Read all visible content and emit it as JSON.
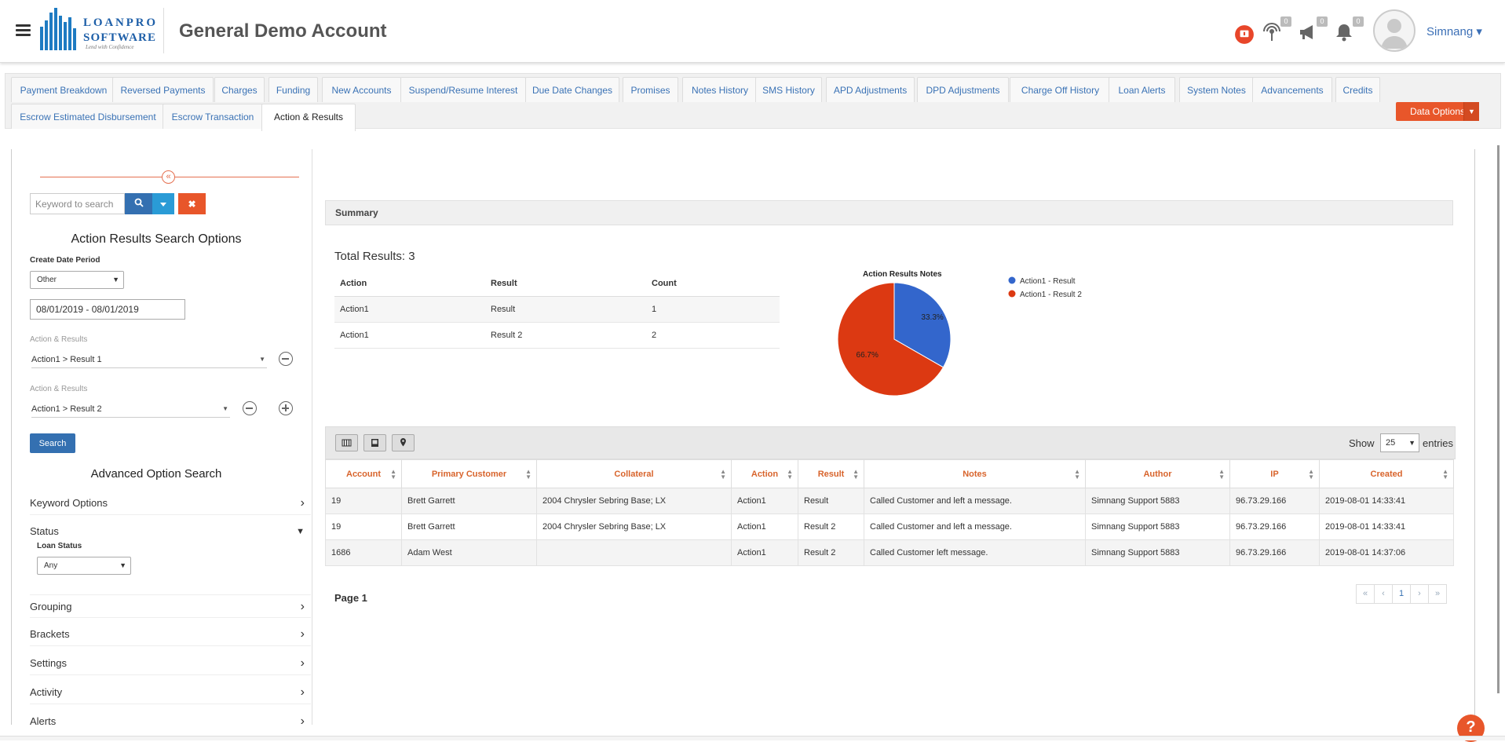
{
  "header": {
    "logo_text": "LOANPRO SOFTWARE",
    "logo_tagline": "Lend with Confidence",
    "account_title": "General Demo Account",
    "notif_counts": [
      "0",
      "0",
      "0"
    ],
    "user_name": "Simnang ▾"
  },
  "tabs": [
    {
      "label": "Payment Breakdown"
    },
    {
      "label": "Reversed Payments"
    },
    {
      "label": "Charges"
    },
    {
      "label": "Funding"
    },
    {
      "label": "New Accounts"
    },
    {
      "label": "Suspend/Resume Interest"
    },
    {
      "label": "Due Date Changes"
    },
    {
      "label": "Promises"
    },
    {
      "label": "Notes History"
    },
    {
      "label": "SMS History"
    },
    {
      "label": "APD Adjustments"
    },
    {
      "label": "DPD Adjustments"
    },
    {
      "label": "Charge Off History"
    },
    {
      "label": "Loan Alerts"
    },
    {
      "label": "System Notes"
    },
    {
      "label": "Advancements"
    },
    {
      "label": "Credits"
    },
    {
      "label": "Escrow Estimated Disbursement"
    },
    {
      "label": "Escrow Transaction"
    },
    {
      "label": "Action & Results",
      "active": true
    }
  ],
  "data_options_label": "Data Options",
  "left": {
    "keyword_placeholder": "Keyword to search",
    "search_options_title": "Action Results Search Options",
    "create_date_label": "Create Date Period",
    "create_date_value": "Other",
    "date_range": "08/01/2019 - 08/01/2019",
    "ar_label": "Action & Results",
    "ar1_value": "Action1 > Result 1",
    "ar2_value": "Action1 > Result 2",
    "search_label": "Search",
    "advanced_title": "Advanced Option Search",
    "acc_keyword": "Keyword Options",
    "acc_status": "Status",
    "loan_status_label": "Loan Status",
    "loan_status_value": "Any",
    "acc_grouping": "Grouping",
    "acc_brackets": "Brackets",
    "acc_settings": "Settings",
    "acc_activity": "Activity",
    "acc_alerts": "Alerts"
  },
  "summary": {
    "title": "Summary",
    "total": "Total Results: 3",
    "headers": [
      "Action",
      "Result",
      "Count"
    ],
    "rows": [
      [
        "Action1",
        "Result",
        "1"
      ],
      [
        "Action1",
        "Result 2",
        "2"
      ]
    ]
  },
  "chart_data": {
    "type": "pie",
    "title": "Action Results Notes",
    "labels": [
      "Action1 - Result",
      "Action1 - Result 2"
    ],
    "values": [
      33.3,
      66.7
    ],
    "value_labels": [
      "33.3%",
      "66.7%"
    ],
    "colors": [
      "#3366cc",
      "#dc3912"
    ],
    "legend": "right"
  },
  "table": {
    "show_label": "Show",
    "show_value": "25",
    "entries_label": "entries",
    "headers": [
      "Account",
      "Primary Customer",
      "Collateral",
      "Action",
      "Result",
      "Notes",
      "Author",
      "IP",
      "Created"
    ],
    "rows": [
      [
        "19",
        "Brett Garrett",
        "2004 Chrysler Sebring Base; LX",
        "Action1",
        "Result",
        "Called Customer and left a message.",
        "Simnang Support 5883",
        "96.73.29.166",
        "2019-08-01 14:33:41"
      ],
      [
        "19",
        "Brett Garrett",
        "2004 Chrysler Sebring Base; LX",
        "Action1",
        "Result 2",
        "Called Customer and left a message.",
        "Simnang Support 5883",
        "96.73.29.166",
        "2019-08-01 14:33:41"
      ],
      [
        "1686",
        "Adam West",
        "",
        "Action1",
        "Result 2",
        "Called Customer left message.",
        "Simnang Support 5883",
        "96.73.29.166",
        "2019-08-01 14:37:06"
      ]
    ],
    "page_label": "Page 1",
    "pager": [
      "«",
      "‹",
      "1",
      "›",
      "»"
    ]
  },
  "help_label": "?"
}
